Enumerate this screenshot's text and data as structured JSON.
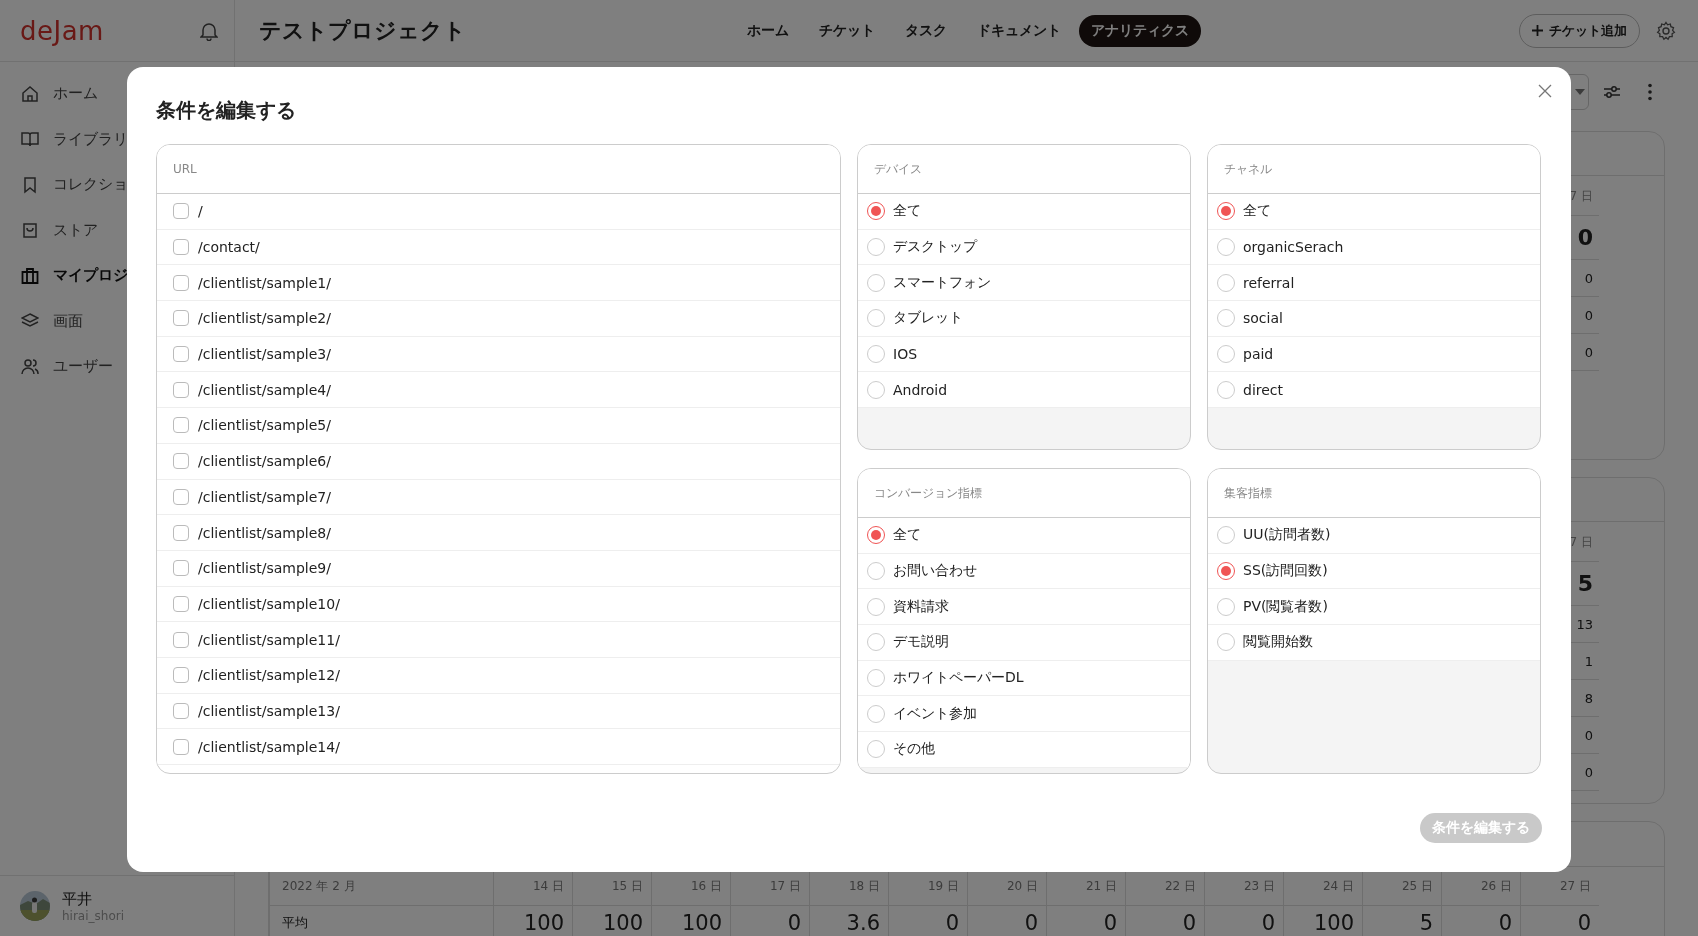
{
  "app": {
    "logo": "deJam"
  },
  "header": {
    "title": "テストプロジェクト",
    "add_button": "チケット追加",
    "nav": [
      {
        "label": "ホーム",
        "selected": false
      },
      {
        "label": "チケット",
        "selected": false
      },
      {
        "label": "タスク",
        "selected": false
      },
      {
        "label": "ドキュメント",
        "selected": false
      },
      {
        "label": "アナリティクス",
        "selected": true
      }
    ]
  },
  "sidebar": {
    "items": [
      {
        "label": "ホーム",
        "selected": false
      },
      {
        "label": "ライブラリ",
        "selected": false
      },
      {
        "label": "コレクショ",
        "selected": false
      },
      {
        "label": "ストア",
        "selected": false
      },
      {
        "label": "マイプロジ",
        "selected": true
      },
      {
        "label": "画面",
        "selected": false
      },
      {
        "label": "ユーザー",
        "selected": false
      }
    ],
    "user": {
      "name": "平井",
      "handle": "hirai_shori"
    }
  },
  "cards": [
    {
      "column_header": "7 日",
      "values": [
        "0",
        "0",
        "0",
        "0"
      ]
    },
    {
      "column_header": "7 日",
      "values": [
        "5",
        "13",
        "1",
        "8",
        "0",
        "0"
      ]
    }
  ],
  "table": {
    "columns": [
      "2022 年 2 月",
      "14 日",
      "15 日",
      "16 日",
      "17 日",
      "18 日",
      "19 日",
      "20 日",
      "21 日",
      "22 日",
      "23 日",
      "24 日",
      "25 日",
      "26 日",
      "27 日"
    ],
    "rows": [
      {
        "cells": [
          "平均",
          "100",
          "100",
          "100",
          "0",
          "3.6",
          "0",
          "0",
          "0",
          "0",
          "0",
          "100",
          "5",
          "0",
          "0"
        ]
      }
    ]
  },
  "modal": {
    "title": "条件を編集する",
    "panels": [
      {
        "title": "URL",
        "kind": "checkbox",
        "options": [
          {
            "label": "/",
            "checked": false
          },
          {
            "label": "/contact/",
            "checked": false
          },
          {
            "label": "/clientlist/sample1/",
            "checked": false
          },
          {
            "label": "/clientlist/sample2/",
            "checked": false
          },
          {
            "label": "/clientlist/sample3/",
            "checked": false
          },
          {
            "label": "/clientlist/sample4/",
            "checked": false
          },
          {
            "label": "/clientlist/sample5/",
            "checked": false
          },
          {
            "label": "/clientlist/sample6/",
            "checked": false
          },
          {
            "label": "/clientlist/sample7/",
            "checked": false
          },
          {
            "label": "/clientlist/sample8/",
            "checked": false
          },
          {
            "label": "/clientlist/sample9/",
            "checked": false
          },
          {
            "label": "/clientlist/sample10/",
            "checked": false
          },
          {
            "label": "/clientlist/sample11/",
            "checked": false
          },
          {
            "label": "/clientlist/sample12/",
            "checked": false
          },
          {
            "label": "/clientlist/sample13/",
            "checked": false
          },
          {
            "label": "/clientlist/sample14/",
            "checked": false
          }
        ]
      },
      {
        "title": "デバイス",
        "kind": "radio",
        "options": [
          {
            "label": "全て",
            "selected": true
          },
          {
            "label": "デスクトップ",
            "selected": false
          },
          {
            "label": "スマートフォン",
            "selected": false
          },
          {
            "label": "タブレット",
            "selected": false
          },
          {
            "label": "IOS",
            "selected": false
          },
          {
            "label": "Android",
            "selected": false
          }
        ]
      },
      {
        "title": "チャネル",
        "kind": "radio",
        "options": [
          {
            "label": "全て",
            "selected": true
          },
          {
            "label": "organicSerach",
            "selected": false
          },
          {
            "label": "referral",
            "selected": false
          },
          {
            "label": "social",
            "selected": false
          },
          {
            "label": "paid",
            "selected": false
          },
          {
            "label": "direct",
            "selected": false
          }
        ]
      },
      {
        "title": "コンバージョン指標",
        "kind": "radio",
        "options": [
          {
            "label": "全て",
            "selected": true
          },
          {
            "label": "お問い合わせ",
            "selected": false
          },
          {
            "label": "資料請求",
            "selected": false
          },
          {
            "label": "デモ説明",
            "selected": false
          },
          {
            "label": "ホワイトペーパーDL",
            "selected": false
          },
          {
            "label": "イベント参加",
            "selected": false
          },
          {
            "label": "その他",
            "selected": false
          }
        ]
      },
      {
        "title": "集客指標",
        "kind": "radio",
        "options": [
          {
            "label": "UU(訪問者数)",
            "selected": false
          },
          {
            "label": "SS(訪問回数)",
            "selected": true
          },
          {
            "label": "PV(閲覧者数)",
            "selected": false
          },
          {
            "label": "閲覧開始数",
            "selected": false
          }
        ]
      }
    ],
    "submit": {
      "label": "条件を編集する",
      "disabled": true
    }
  }
}
